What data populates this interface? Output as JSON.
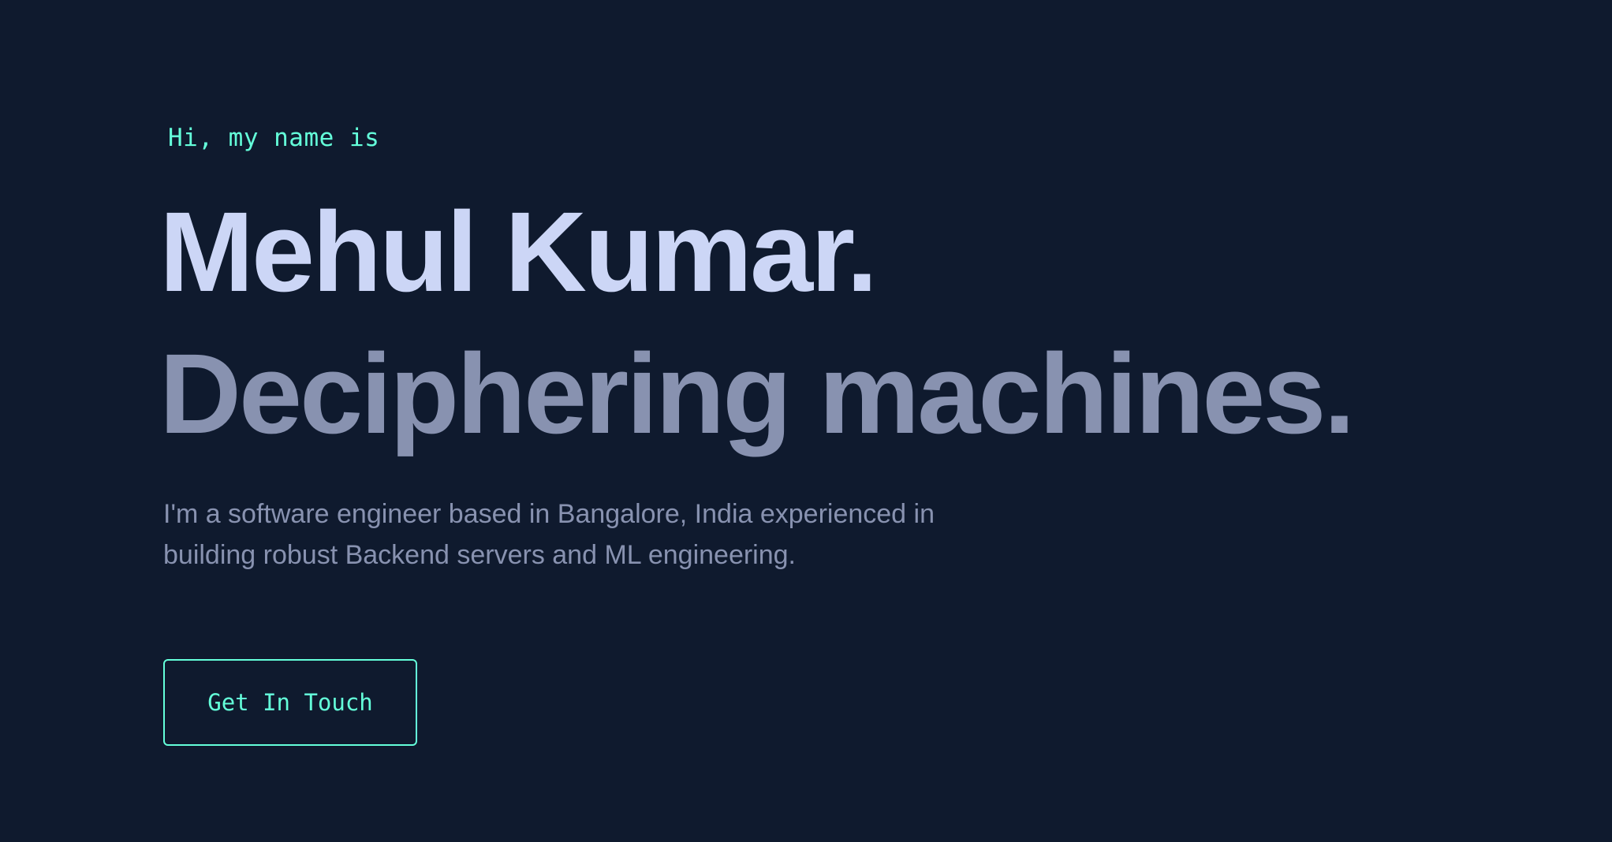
{
  "hero": {
    "greeting": "Hi, my name is",
    "name": "Mehul Kumar.",
    "tagline": "Deciphering machines.",
    "description": "I'm a software engineer based in Bangalore, India experienced in building robust Backend servers and ML engineering.",
    "cta_label": "Get In Touch"
  },
  "colors": {
    "background": "#0f1a2e",
    "accent": "#64ffda",
    "heading": "#ccd6f6",
    "muted": "#8892b0"
  }
}
